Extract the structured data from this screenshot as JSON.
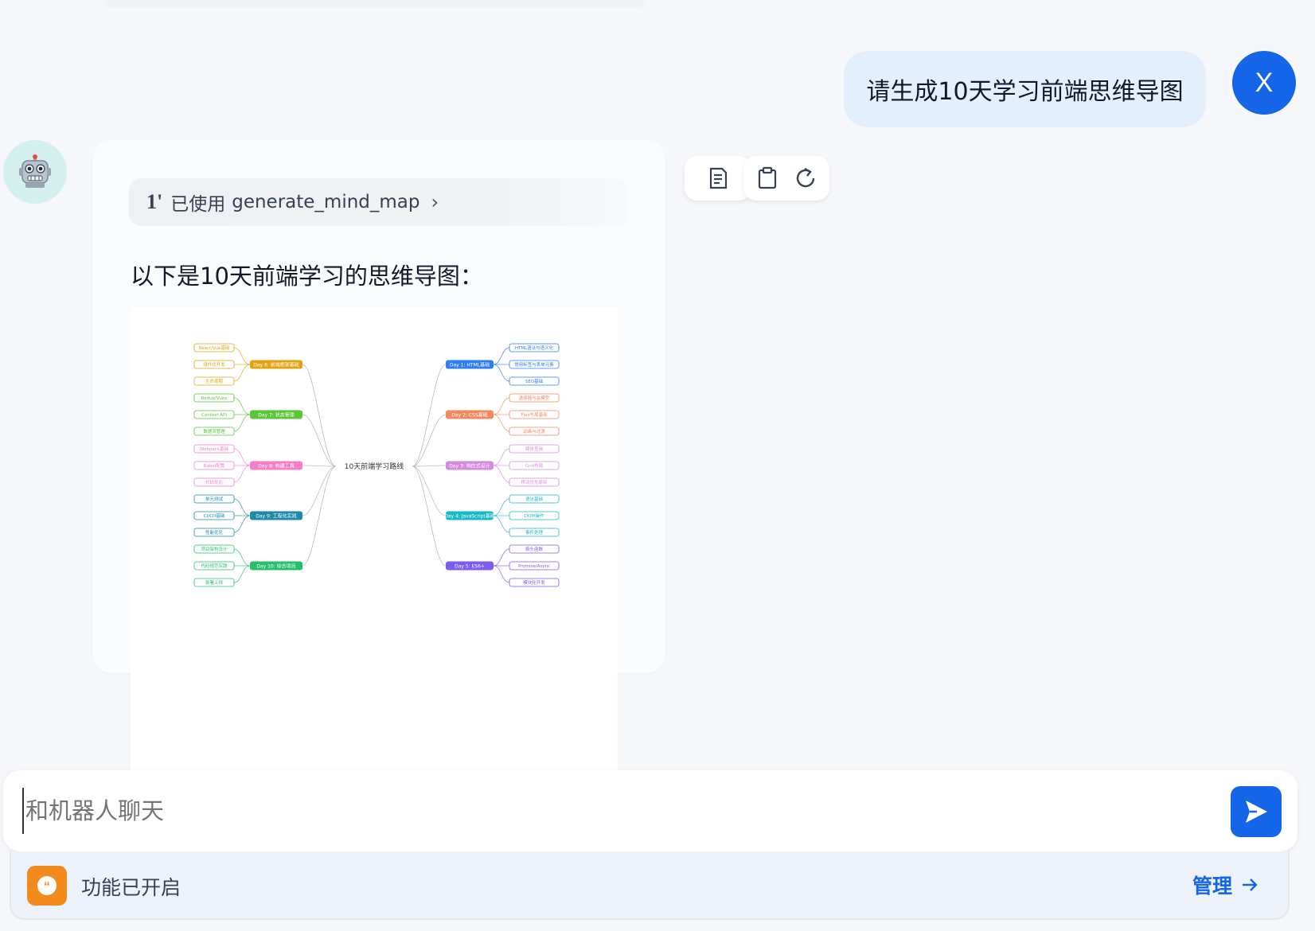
{
  "user": {
    "message": "请生成10天学习前端思维导图",
    "avatar_letter": "X"
  },
  "bot": {
    "avatar_icon": "robot-icon",
    "tool_call": {
      "prefix": "已使用",
      "name": "generate_mind_map"
    },
    "text": "以下是10天前端学习的思维导图：",
    "actions": [
      "document-icon",
      "clipboard-icon",
      "refresh-icon"
    ]
  },
  "mindmap": {
    "root": "10天前端学习路线",
    "right": [
      {
        "label": "Day 1: HTML基础",
        "color": "#2f7cf6",
        "children": [
          "HTML语法与语义化",
          "常用标签与表单元素",
          "SEO基础"
        ]
      },
      {
        "label": "Day 2: CSS基础",
        "color": "#f08a5d",
        "children": [
          "选择器与盒模型",
          "Flex布局基础",
          "动画与过渡"
        ]
      },
      {
        "label": "Day 3: 响应式设计",
        "color": "#d58ae0",
        "children": [
          "媒体查询",
          "Grid布局",
          "移动优先原则"
        ]
      },
      {
        "label": "Day 4: JavaScript基础",
        "color": "#17b8c8",
        "children": [
          "语法基础",
          "DOM操作",
          "事件处理"
        ]
      },
      {
        "label": "Day 5: ES6+",
        "color": "#7a5cf0",
        "children": [
          "箭头函数",
          "Promise/Async",
          "模块化开发"
        ]
      }
    ],
    "left": [
      {
        "label": "Day 6: 前端框架基础",
        "color": "#e2a313",
        "children": [
          "React/Vue基础",
          "组件化开发",
          "生命周期"
        ]
      },
      {
        "label": "Day 7: 状态管理",
        "color": "#58c637",
        "children": [
          "Redux/Vuex",
          "Context API",
          "数据流管理"
        ]
      },
      {
        "label": "Day 8: 构建工具",
        "color": "#f47fc6",
        "children": [
          "Webpack基础",
          "Babel配置",
          "代码优化"
        ]
      },
      {
        "label": "Day 9: 工程化实践",
        "color": "#1e8aa8",
        "children": [
          "单元测试",
          "CI/CD基础",
          "性能优化"
        ]
      },
      {
        "label": "Day 10: 综合项目",
        "color": "#27c06a",
        "children": [
          "项目架构设计",
          "代码规范实践",
          "部署上线"
        ]
      }
    ]
  },
  "composer": {
    "placeholder": "和机器人聊天",
    "send_icon": "send-icon"
  },
  "features": {
    "label": "功能已开启",
    "manage": "管理",
    "icon": "quote-icon",
    "icon_color": "#f28a1c"
  },
  "colors": {
    "accent": "#1565e8",
    "user_bubble": "#e3effc",
    "bot_avatar_bg": "#d5f1ef"
  }
}
